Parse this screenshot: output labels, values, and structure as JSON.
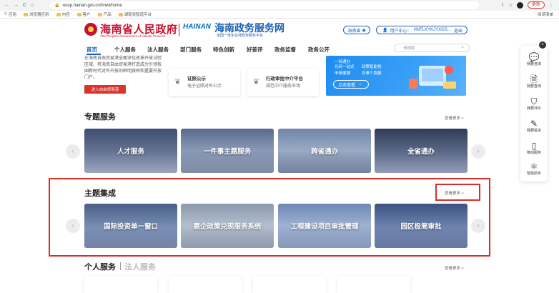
{
  "browser": {
    "url": "wssp.hainan.gov.cn/hnwt/home",
    "update_label": "更新",
    "reading_list": "阅读清单",
    "bookmarks": [
      "应用",
      "浏览器应用",
      "内控",
      "客户",
      "产品",
      "湖南省智造平台"
    ]
  },
  "header": {
    "gov_title": "海南省人民政府",
    "gov_subtitle": "The People's Government of Hainan Province",
    "logo_text": "HAINAN",
    "service_title": "海南政务服务网",
    "service_subtitle": "全国一体化在线政务服务平台",
    "region": "海南省",
    "user_label": "用户中心：",
    "user_name": "HNTLKYKJYXGS...",
    "logout": "退出"
  },
  "nav": {
    "items": [
      "首页",
      "个人服务",
      "法人服务",
      "部门服务",
      "特色创新",
      "好差评",
      "政务监督",
      "政务公开"
    ],
    "search_placeholder": "请搜索"
  },
  "hero": {
    "text": "在海南自由贸易港全面深化改革开放试验区域，将海南自由贸易港打造成为引领我国新时代对外开放的鲜明旗帜和重要开放门户。",
    "enter_button": "进入自由贸易港",
    "cards": [
      {
        "title": "证照公示",
        "desc": "电子证照对外公示"
      },
      {
        "title": "行政审批中介平台",
        "desc": "规范中介服务市场"
      }
    ],
    "banner": {
      "bullets": [
        "一网通办",
        "光网一站式",
        "政策智能找",
        "申报便捷",
        "办事少跑腿"
      ],
      "cta": "点击查看"
    }
  },
  "topic_services": {
    "title": "专题服务",
    "more": "查看更多 >",
    "items": [
      "人才服务",
      "一件事主题服务",
      "跨省通办",
      "全省通办"
    ]
  },
  "theme_integration": {
    "title": "主题集成",
    "more": "查看更多 >",
    "items": [
      "国际投资单一窗口",
      "惠企政策兑现服务系统",
      "工程建设项目审批管理",
      "园区极简审批"
    ]
  },
  "personal_section": {
    "title_a": "个人服务",
    "title_b": "法人服务",
    "more": "查看更多 >"
  },
  "toolbar": {
    "items": [
      "我要咨询",
      "我要查询",
      "我要评价",
      "我要投诉",
      "移动服务",
      "智能助手"
    ]
  },
  "colors": {
    "brand_red": "#c8102e",
    "brand_blue": "#1a5fb4",
    "highlight_red": "#d93025"
  }
}
